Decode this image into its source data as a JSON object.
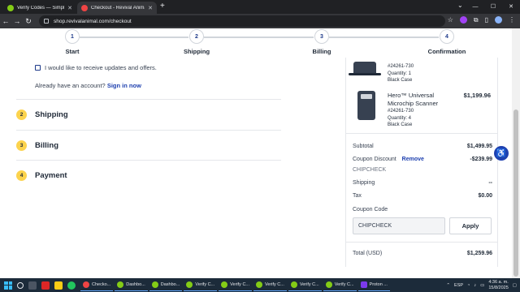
{
  "browser": {
    "tabs": [
      {
        "title": "Verify Codes — SimplyCodes",
        "favicon_color": "#84cc16",
        "active": false
      },
      {
        "title": "Checkout - Revival Animal Hea",
        "favicon_color": "#ef4444",
        "active": true
      }
    ],
    "url": "shop.revivalanimal.com/checkout"
  },
  "stepper": {
    "steps": [
      {
        "number": "1",
        "label": "Start"
      },
      {
        "number": "2",
        "label": "Shipping"
      },
      {
        "number": "3",
        "label": "Billing"
      },
      {
        "number": "4",
        "label": "Confirmation"
      }
    ]
  },
  "checkout": {
    "newsletter_label": "I would like to receive updates and offers.",
    "account_prompt": "Already have an account?",
    "sign_in_link": "Sign in now",
    "sections": [
      {
        "number": "2",
        "label": "Shipping"
      },
      {
        "number": "3",
        "label": "Billing"
      },
      {
        "number": "4",
        "label": "Payment"
      }
    ]
  },
  "summary": {
    "item1": {
      "sku": "#24261-730",
      "quantity": "Quantity: 1",
      "variant": "Black Case"
    },
    "item2": {
      "name": "Hero™ Universal Microchip Scanner",
      "sku": "#24261-730",
      "quantity": "Quantity: 4",
      "variant": "Black Case",
      "price": "$1,199.96"
    },
    "subtotal_label": "Subtotal",
    "subtotal_value": "$1,499.95",
    "coupon_label": "Coupon Discount",
    "remove_link": "Remove",
    "coupon_value": "-$239.99",
    "coupon_code": "CHIPCHECK",
    "shipping_label": "Shipping",
    "shipping_value": "--",
    "tax_label": "Tax",
    "tax_value": "$0.00",
    "coupon_code_label": "Coupon Code",
    "coupon_input_value": "CHIPCHECK",
    "apply_label": "Apply",
    "total_label": "Total (USD)",
    "total_value": "$1,259.96"
  },
  "taskbar": {
    "apps": [
      {
        "label": "Checko...",
        "color": "#ef4444"
      },
      {
        "label": "Dashbo...",
        "color": "#84cc16"
      },
      {
        "label": "Dashbo...",
        "color": "#84cc16"
      },
      {
        "label": "Verify C...",
        "color": "#84cc16"
      },
      {
        "label": "Verify C...",
        "color": "#84cc16"
      },
      {
        "label": "Verify C...",
        "color": "#84cc16"
      },
      {
        "label": "Verify C...",
        "color": "#84cc16"
      },
      {
        "label": "Verify C...",
        "color": "#84cc16"
      },
      {
        "label": "Proton ...",
        "color": "#7c3aed"
      }
    ],
    "language": "ESP",
    "time": "4:36 a. m.",
    "date": "15/8/2025"
  }
}
